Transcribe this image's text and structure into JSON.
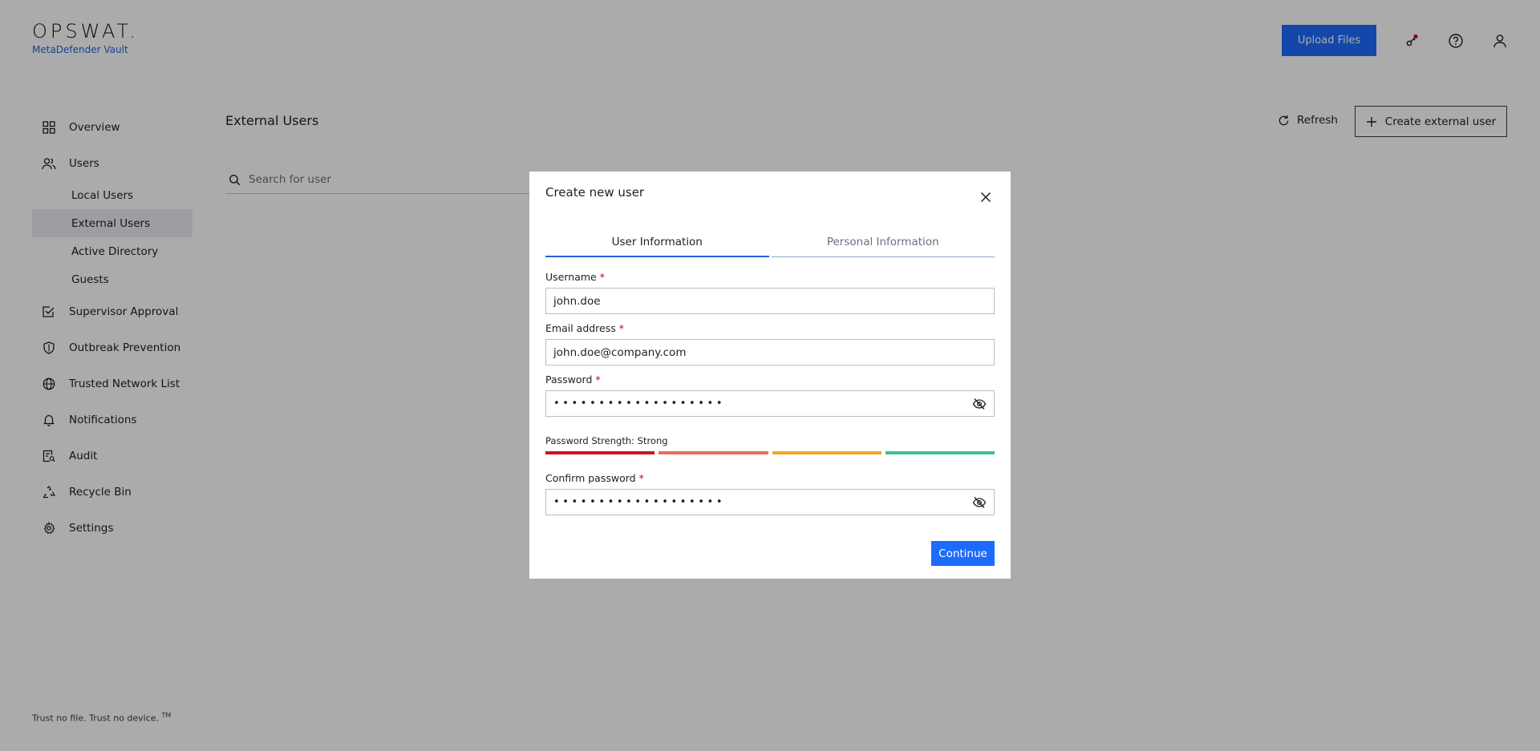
{
  "app": {
    "logo_word": "OPSWAT.",
    "product": "MetaDefender Vault",
    "footer": "Trust no file. Trust no device.",
    "footer_tm": "TM"
  },
  "header": {
    "upload_label": "Upload Files",
    "icons": [
      "key-notification-icon",
      "help-icon",
      "user-icon"
    ]
  },
  "sidebar": {
    "items": [
      {
        "label": "Overview",
        "icon": "grid-icon"
      },
      {
        "label": "Users",
        "icon": "users-icon"
      },
      {
        "label": "Supervisor Approval",
        "icon": "checklist-icon"
      },
      {
        "label": "Outbreak Prevention",
        "icon": "shield-icon"
      },
      {
        "label": "Trusted Network List",
        "icon": "globe-icon"
      },
      {
        "label": "Notifications",
        "icon": "bell-icon"
      },
      {
        "label": "Audit",
        "icon": "audit-icon"
      },
      {
        "label": "Recycle Bin",
        "icon": "recycle-icon"
      },
      {
        "label": "Settings",
        "icon": "gear-icon"
      }
    ],
    "users_sub": [
      {
        "label": "Local Users"
      },
      {
        "label": "External Users",
        "active": true
      },
      {
        "label": "Active Directory"
      },
      {
        "label": "Guests"
      }
    ]
  },
  "main": {
    "title": "External Users",
    "refresh_label": "Refresh",
    "create_label": "Create external user",
    "search_placeholder": "Search for user"
  },
  "modal": {
    "title": "Create new user",
    "tabs": [
      {
        "label": "User Information",
        "active": true
      },
      {
        "label": "Personal Information",
        "active": false
      }
    ],
    "username_label": "Username",
    "username_value": "john.doe",
    "email_label": "Email address",
    "email_value": "john.doe@company.com",
    "password_label": "Password",
    "password_value": "•••••••••••••••••••",
    "strength_label": "Password Strength: Strong",
    "strength_colors": [
      "#d0121b",
      "#ee6b55",
      "#f5a623",
      "#3fbf8a"
    ],
    "confirm_label": "Confirm password",
    "confirm_value": "•••••••••••••••••••",
    "required_mark": "*",
    "continue_label": "Continue"
  },
  "colors": {
    "accent": "#1d6bfc",
    "brand": "#1f66d6",
    "required": "#d0021b"
  }
}
